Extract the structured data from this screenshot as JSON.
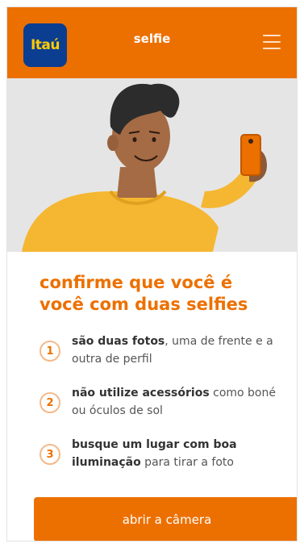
{
  "header": {
    "logo_text": "Itaú",
    "title": "selfie",
    "brand_color": "#ec7000",
    "logo_bg": "#0b3d91",
    "logo_fg": "#ffcc00",
    "menu_icon": "hamburger-menu-icon"
  },
  "illustration": {
    "icon": "person-taking-selfie-illustration"
  },
  "main": {
    "headline": "confirme que você é você com duas selfies",
    "steps": [
      {
        "number": "1",
        "bold": "são duas fotos",
        "rest": ", uma de frente e a outra de perfil"
      },
      {
        "number": "2",
        "bold": "não utilize acessórios",
        "rest": " como boné ou óculos de sol"
      },
      {
        "number": "3",
        "bold": "busque um lugar com boa iluminação",
        "rest": " para tirar a foto"
      }
    ]
  },
  "cta": {
    "label": "abrir a câmera"
  }
}
